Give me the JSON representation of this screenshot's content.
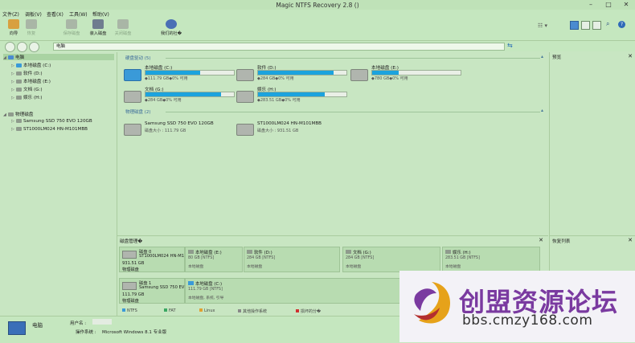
{
  "window": {
    "title": "Magic NTFS Recovery 2.8 ()"
  },
  "menu": [
    "文件(Z)",
    "调板(V)",
    "查看(X)",
    "工具(W)",
    "帮助(V)"
  ],
  "toolbar": {
    "wizard": "向导",
    "restore": "恢复",
    "save_disk": "保存磁盘",
    "mount_disk": "装入磁盘",
    "close_disk": "关闭磁盘",
    "about": "我们的社�"
  },
  "address": {
    "value": "电脑"
  },
  "tree": {
    "root": "电脑",
    "items": [
      "本地磁盘 (C:)",
      "软件 (D:)",
      "本地磁盘 (E:)",
      "文档 (G:)",
      "娱乐 (H:)"
    ],
    "physical_root": "物理磁盘",
    "physical_items": [
      "Samsung SSD 750 EVO 120GB",
      "ST1000LM024 HN-M101MBB"
    ]
  },
  "main": {
    "hard_drives_header": "硬盘驱动 (5)",
    "drives": [
      {
        "name": "本地磁盘 (C:)",
        "free": "◆111.79 GB◆0% 可用",
        "used": 0.62
      },
      {
        "name": "软件 (D:)",
        "free": "◆284 GB◆0% 可用",
        "used": 0.85
      },
      {
        "name": "本地磁盘 (E:)",
        "free": "◆780 GB◆0% 可用",
        "used": 0.3
      },
      {
        "name": "文档 (G:)",
        "free": "◆284 GB◆0% 可用",
        "used": 0.85
      },
      {
        "name": "娱乐 (H:)",
        "free": "◆283.51 GB◆0% 可用",
        "used": 0.75
      }
    ],
    "physical_header": "物理磁盘 (2)",
    "physical": [
      {
        "name": "Samsung SSD 750 EVO 120GB",
        "size": "磁盘大小 : 111.79 GB"
      },
      {
        "name": "ST1000LM024 HN-M101MBB",
        "size": "磁盘大小 : 931.51 GB"
      }
    ]
  },
  "preview": {
    "title": "预览"
  },
  "recovery_list": {
    "title": "恢复列表"
  },
  "disk_mgmt": {
    "title": "磁盘管理�",
    "disks": [
      {
        "name": "磁盘 0",
        "model": "ST1000LM024 HN-M1",
        "size": "931.51 GB",
        "type": "物理磁盘"
      },
      {
        "name": "磁盘 1",
        "model": "Samsung SSD 750 EV",
        "size": "111.79 GB",
        "type": "物理磁盘"
      }
    ],
    "parts0": [
      {
        "name": "本地磁盘 (E:)",
        "size": "80 GB [NTFS]",
        "type": "本地磁盘"
      },
      {
        "name": "软件 (D:)",
        "size": "284 GB [NTFS]",
        "type": "本地磁盘"
      },
      {
        "name": "文档 (G:)",
        "size": "284 GB [NTFS]",
        "type": "本地磁盘"
      },
      {
        "name": "娱乐 (H:)",
        "size": "283.51 GB [NTFS]",
        "type": "本地磁盘"
      }
    ],
    "parts1": [
      {
        "name": "本地磁盘 (C:)",
        "size": "111.79 GB [NTFS]",
        "type": "本地磁盘, 系统, 引导"
      }
    ],
    "legend": [
      "NTFS",
      "FAT",
      "Linux",
      "其他操作系统",
      "损坏的分�"
    ]
  },
  "status": {
    "name": "电脑",
    "username_label": "用户名 :",
    "os_label": "操作系统 :",
    "os_value": "Microsoft Windows 8.1 专业版"
  },
  "watermark": {
    "title": "创盟资源论坛",
    "url": "bbs.cmzy168.com"
  },
  "colors": {
    "bar_fill": "#1ca3dd",
    "background": "#c8e6c2",
    "header_text": "#3a6b9a"
  }
}
